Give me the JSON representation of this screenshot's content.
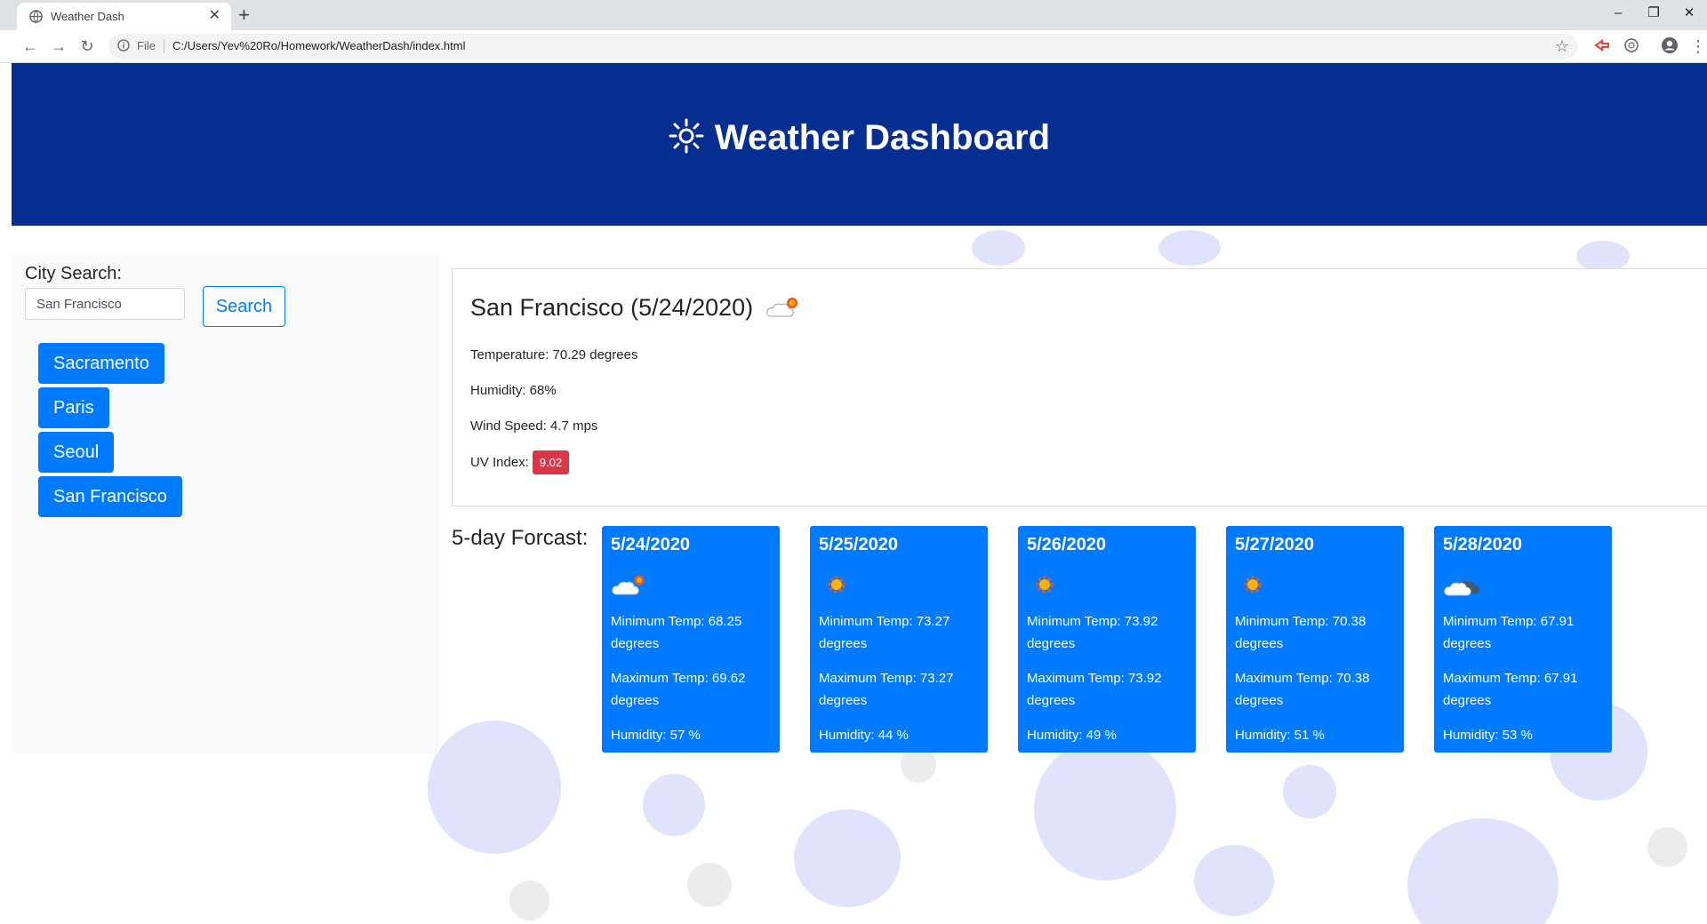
{
  "browser": {
    "tab_title": "Weather Dash",
    "tab_close": "✕",
    "new_tab": "+",
    "scheme": "File",
    "url": "C:/Users/Yev%20Ro/Homework/WeatherDash/index.html",
    "back": "←",
    "forward": "→",
    "reload": "↻",
    "minimize": "–",
    "restore": "❐",
    "close": "✕",
    "star": "☆",
    "menu": "⋮"
  },
  "header": {
    "title": "Weather Dashboard",
    "icon": "sun-icon"
  },
  "sidebar": {
    "label": "City Search:",
    "input_value": "San Francisco",
    "search_button": "Search",
    "cities": [
      "Sacramento",
      "Paris",
      "Seoul",
      "San Francisco"
    ]
  },
  "current": {
    "title": "San Francisco (5/24/2020)",
    "icon": "partly-cloudy-icon",
    "temperature": "Temperature: 70.29 degrees",
    "humidity": "Humidity: 68%",
    "wind": "Wind Speed: 4.7 mps",
    "uv_label": "UV Index:",
    "uv_value": "9.02",
    "uv_color": "#dc3545"
  },
  "forecast": {
    "label": "5-day Forcast:",
    "card_color": "#007bff",
    "days": [
      {
        "date": "5/24/2020",
        "icon": "partly-cloudy-icon",
        "min": "Minimum Temp: 68.25 degrees",
        "max": "Maximum Temp: 69.62 degrees",
        "humidity": "Humidity: 57 %"
      },
      {
        "date": "5/25/2020",
        "icon": "sun-icon",
        "min": "Minimum Temp: 73.27 degrees",
        "max": "Maximum Temp: 73.27 degrees",
        "humidity": "Humidity: 44 %"
      },
      {
        "date": "5/26/2020",
        "icon": "sun-icon",
        "min": "Minimum Temp: 73.92 degrees",
        "max": "Maximum Temp: 73.92 degrees",
        "humidity": "Humidity: 49 %"
      },
      {
        "date": "5/27/2020",
        "icon": "sun-icon",
        "min": "Minimum Temp: 70.38 degrees",
        "max": "Maximum Temp: 70.38 degrees",
        "humidity": "Humidity: 51 %"
      },
      {
        "date": "5/28/2020",
        "icon": "cloudy-icon",
        "min": "Minimum Temp: 67.91 degrees",
        "max": "Maximum Temp: 67.91 degrees",
        "humidity": "Humidity: 53 %"
      }
    ]
  }
}
